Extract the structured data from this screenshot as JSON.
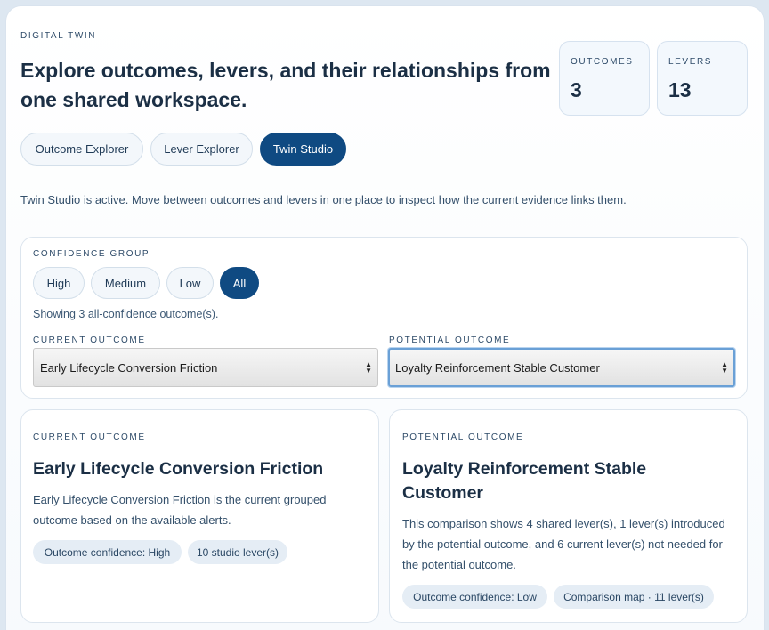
{
  "header": {
    "eyebrow": "DIGITAL TWIN",
    "title": "Explore outcomes, levers, and their relationships from one shared workspace."
  },
  "stats": [
    {
      "label": "OUTCOMES",
      "value": "3"
    },
    {
      "label": "LEVERS",
      "value": "13"
    }
  ],
  "tabs": [
    {
      "label": "Outcome Explorer",
      "active": false
    },
    {
      "label": "Lever Explorer",
      "active": false
    },
    {
      "label": "Twin Studio",
      "active": true
    }
  ],
  "status_text": "Twin Studio is active. Move between outcomes and levers in one place to inspect how the current evidence links them.",
  "filter": {
    "label": "CONFIDENCE GROUP",
    "options": [
      "High",
      "Medium",
      "Low",
      "All"
    ],
    "selected": "All",
    "showing": "Showing 3 all-confidence outcome(s).",
    "current_label": "CURRENT OUTCOME",
    "current_value": "Early Lifecycle Conversion Friction",
    "potential_label": "POTENTIAL OUTCOME",
    "potential_value": "Loyalty Reinforcement Stable Customer"
  },
  "current_card": {
    "eyebrow": "CURRENT OUTCOME",
    "title": "Early Lifecycle Conversion Friction",
    "text": "Early Lifecycle Conversion Friction is the current grouped outcome based on the available alerts.",
    "tags": [
      "Outcome confidence: High",
      "10 studio lever(s)"
    ]
  },
  "potential_card": {
    "eyebrow": "POTENTIAL OUTCOME",
    "title": "Loyalty Reinforcement Stable Customer",
    "text": "This comparison shows 4 shared lever(s), 1 lever(s) introduced by the potential outcome, and 6 current lever(s) not needed for the potential outcome.",
    "tags": [
      "Outcome confidence: Low",
      "Comparison map · 11 lever(s)"
    ]
  },
  "colors": {
    "accent": "#0f4a82",
    "pill_bg": "#f3f7fb",
    "tag_bg": "#e5edf5",
    "page_bg": "#dde7f1"
  },
  "icons": {
    "select_arrows": "up-down-arrows-icon"
  }
}
